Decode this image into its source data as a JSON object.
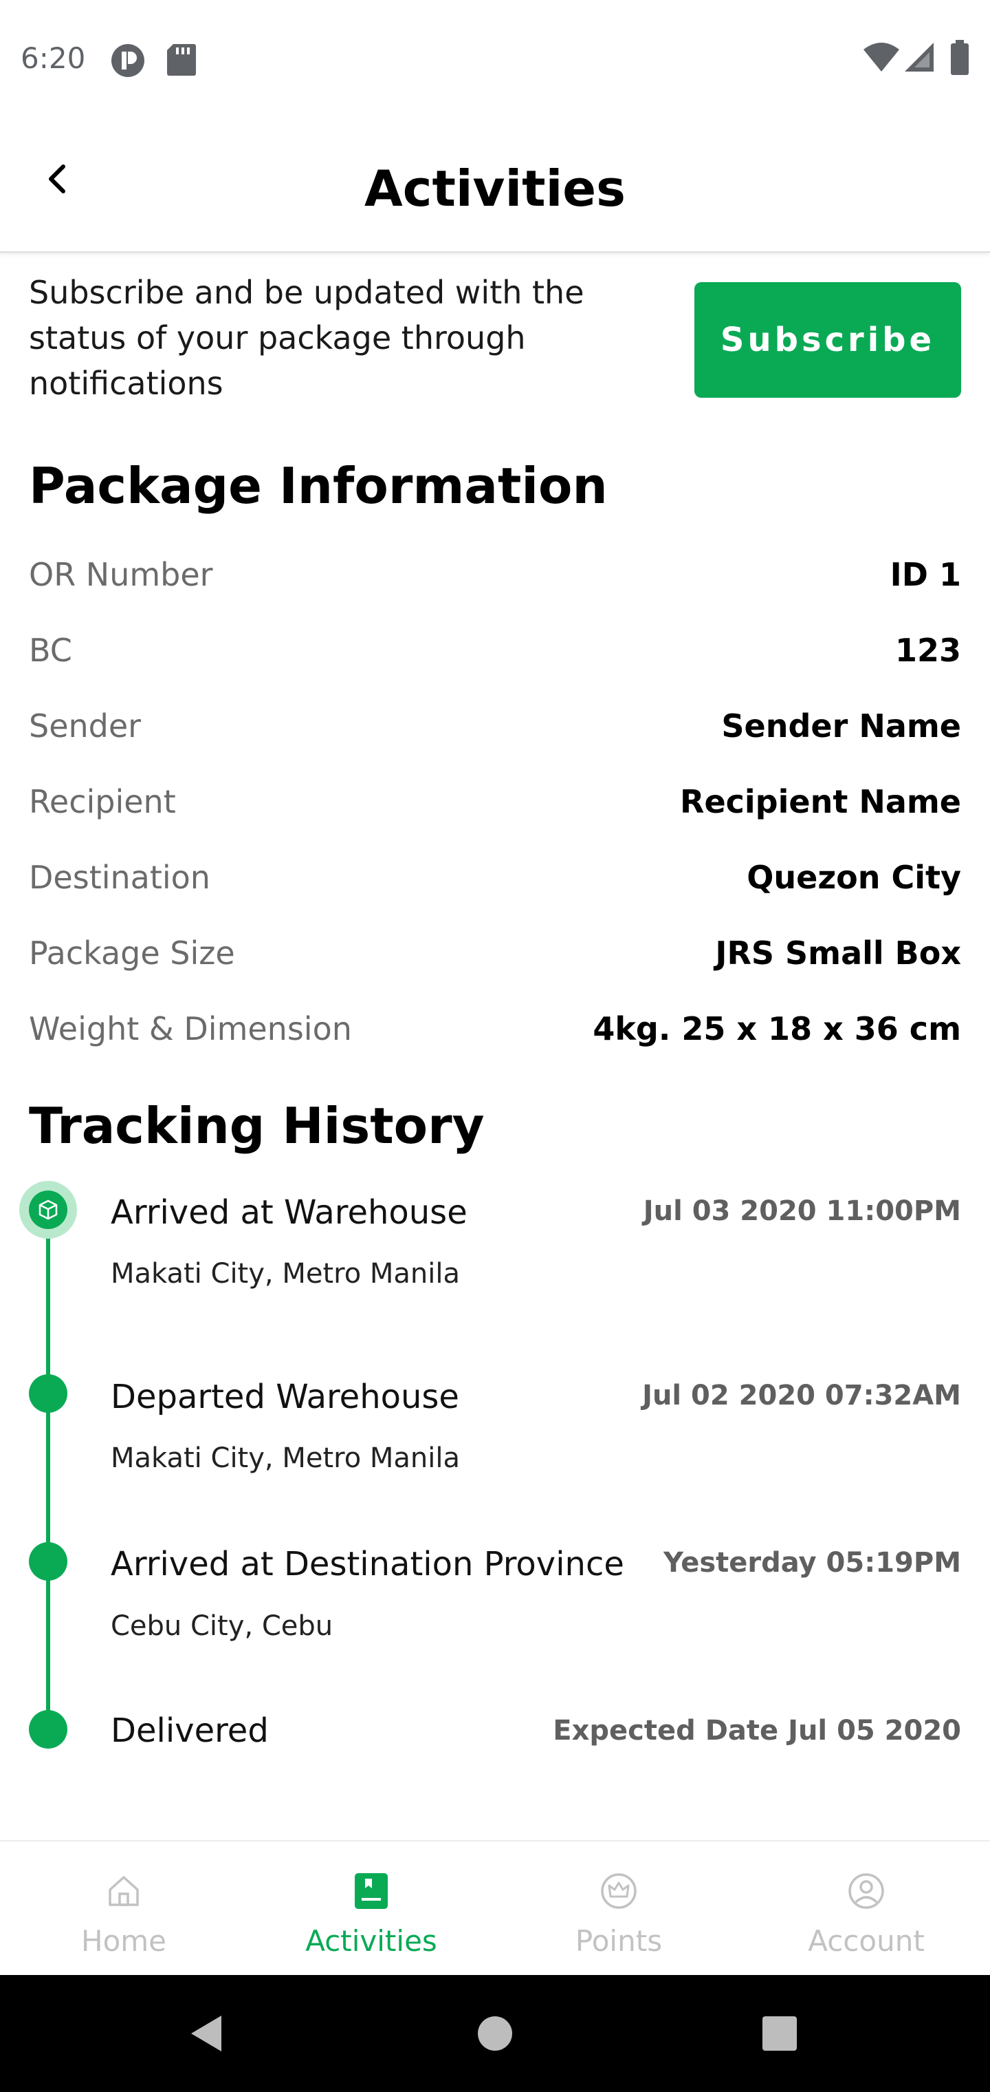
{
  "status_bar": {
    "time": "6:20"
  },
  "header": {
    "title": "Activities"
  },
  "subscribe": {
    "text": "Subscribe and be updated with the status of your package through notifications",
    "button_label": "Subscribe"
  },
  "package_info": {
    "title": "Package Information",
    "rows": [
      {
        "label": "OR Number",
        "value": "ID 1"
      },
      {
        "label": "BC",
        "value": "123"
      },
      {
        "label": "Sender",
        "value": "Sender Name"
      },
      {
        "label": "Recipient",
        "value": "Recipient Name"
      },
      {
        "label": "Destination",
        "value": "Quezon City"
      },
      {
        "label": "Package Size",
        "value": "JRS Small Box"
      },
      {
        "label": "Weight & Dimension",
        "value": "4kg. 25 x 18 x 36 cm"
      }
    ]
  },
  "tracking": {
    "title": "Tracking History",
    "events": [
      {
        "title": "Arrived at Warehouse",
        "location": "Makati City, Metro Manila",
        "date": "Jul 03 2020 11:00PM"
      },
      {
        "title": "Departed Warehouse",
        "location": "Makati City, Metro Manila",
        "date": "Jul 02 2020 07:32AM"
      },
      {
        "title": "Arrived at Destination Province",
        "location": "Cebu City, Cebu",
        "date": "Yesterday 05:19PM"
      },
      {
        "title": "Delivered",
        "location": "",
        "date": "Expected Date Jul 05 2020"
      }
    ]
  },
  "bottom_nav": {
    "items": [
      {
        "label": "Home",
        "icon": "home-icon"
      },
      {
        "label": "Activities",
        "icon": "activities-icon"
      },
      {
        "label": "Points",
        "icon": "crown-icon"
      },
      {
        "label": "Account",
        "icon": "account-icon"
      }
    ],
    "active": "Activities"
  },
  "colors": {
    "accent": "#0aaa55",
    "inactive": "#c2c2c2"
  }
}
